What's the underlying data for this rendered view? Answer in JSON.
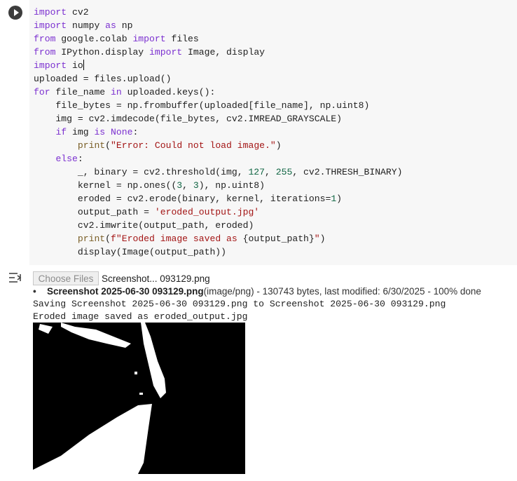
{
  "cell": {
    "run_icon": "play-circle-icon",
    "code_lines": [
      [
        {
          "t": "import",
          "c": "kw"
        },
        {
          "t": " cv2",
          "c": "fn"
        }
      ],
      [
        {
          "t": "import",
          "c": "kw"
        },
        {
          "t": " numpy ",
          "c": "fn"
        },
        {
          "t": "as",
          "c": "kw"
        },
        {
          "t": " np",
          "c": "fn"
        }
      ],
      [
        {
          "t": "from",
          "c": "kw"
        },
        {
          "t": " google.colab ",
          "c": "fn"
        },
        {
          "t": "import",
          "c": "kw"
        },
        {
          "t": " files",
          "c": "fn"
        }
      ],
      [
        {
          "t": "from",
          "c": "kw"
        },
        {
          "t": " IPython.display ",
          "c": "fn"
        },
        {
          "t": "import",
          "c": "kw"
        },
        {
          "t": " Image, display",
          "c": "fn"
        }
      ],
      [
        {
          "t": "import",
          "c": "kw"
        },
        {
          "t": " io",
          "c": "fn"
        },
        {
          "t": "",
          "c": "cursor"
        }
      ],
      [
        {
          "t": "uploaded = files.upload()",
          "c": "fn"
        }
      ],
      [
        {
          "t": "for",
          "c": "kw"
        },
        {
          "t": " file_name ",
          "c": "fn"
        },
        {
          "t": "in",
          "c": "kw"
        },
        {
          "t": " uploaded.keys():",
          "c": "fn"
        }
      ],
      [
        {
          "t": "    file_bytes = np.frombuffer(uploaded[file_name], np.uint8)",
          "c": "fn"
        }
      ],
      [
        {
          "t": "    img = cv2.imdecode(file_bytes, cv2.IMREAD_GRAYSCALE)",
          "c": "fn"
        }
      ],
      [
        {
          "t": "    ",
          "c": "fn"
        },
        {
          "t": "if",
          "c": "kw"
        },
        {
          "t": " img ",
          "c": "fn"
        },
        {
          "t": "is",
          "c": "kw"
        },
        {
          "t": " ",
          "c": "fn"
        },
        {
          "t": "None",
          "c": "kw"
        },
        {
          "t": ":",
          "c": "fn"
        }
      ],
      [
        {
          "t": "        ",
          "c": "fn"
        },
        {
          "t": "print",
          "c": "bi"
        },
        {
          "t": "(",
          "c": "fn"
        },
        {
          "t": "\"Error: Could not load image.\"",
          "c": "str"
        },
        {
          "t": ")",
          "c": "fn"
        }
      ],
      [
        {
          "t": "    ",
          "c": "fn"
        },
        {
          "t": "else",
          "c": "kw"
        },
        {
          "t": ":",
          "c": "fn"
        }
      ],
      [
        {
          "t": "        _, binary = cv2.threshold(img, ",
          "c": "fn"
        },
        {
          "t": "127",
          "c": "num"
        },
        {
          "t": ", ",
          "c": "fn"
        },
        {
          "t": "255",
          "c": "num"
        },
        {
          "t": ", cv2.THRESH_BINARY)",
          "c": "fn"
        }
      ],
      [
        {
          "t": "        kernel = np.ones((",
          "c": "fn"
        },
        {
          "t": "3",
          "c": "num"
        },
        {
          "t": ", ",
          "c": "fn"
        },
        {
          "t": "3",
          "c": "num"
        },
        {
          "t": "), np.uint8)",
          "c": "fn"
        }
      ],
      [
        {
          "t": "        eroded = cv2.erode(binary, kernel, iterations=",
          "c": "fn"
        },
        {
          "t": "1",
          "c": "num"
        },
        {
          "t": ")",
          "c": "fn"
        }
      ],
      [
        {
          "t": "        output_path = ",
          "c": "fn"
        },
        {
          "t": "'eroded_output.jpg'",
          "c": "str"
        }
      ],
      [
        {
          "t": "        cv2.imwrite(output_path, eroded)",
          "c": "fn"
        }
      ],
      [
        {
          "t": "        ",
          "c": "fn"
        },
        {
          "t": "print",
          "c": "bi"
        },
        {
          "t": "(",
          "c": "fn"
        },
        {
          "t": "f\"Eroded image saved as ",
          "c": "str"
        },
        {
          "t": "{output_path}",
          "c": "fn"
        },
        {
          "t": "\"",
          "c": "str"
        },
        {
          "t": ")",
          "c": "fn"
        }
      ],
      [
        {
          "t": "        display(Image(output_path))",
          "c": "fn"
        }
      ]
    ]
  },
  "output": {
    "icon": "output-menu-icon",
    "choose_files_label": "Choose Files",
    "chosen_file_label": "Screenshot... 093129.png",
    "file_entry": {
      "bullet": "•",
      "name": "Screenshot 2025-06-30 093129.png",
      "details": "(image/png) - 130743 bytes, last modified: 6/30/2025 - 100% done"
    },
    "lines": [
      "Saving Screenshot 2025-06-30 093129.png to Screenshot 2025-06-30 093129.png",
      "Eroded image saved as eroded_output.jpg"
    ]
  }
}
